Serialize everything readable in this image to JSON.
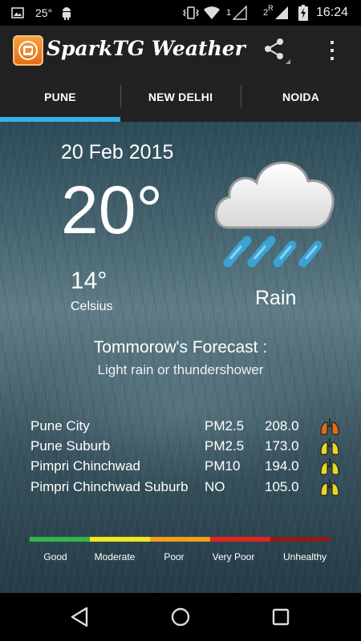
{
  "status_bar": {
    "temperature": "25°",
    "sim1": "1",
    "sim2": "2",
    "roaming": "R",
    "time": "16:24"
  },
  "app_bar": {
    "title": "SparkTG Weather"
  },
  "tabs": [
    {
      "label": "PUNE",
      "selected": true
    },
    {
      "label": "NEW DELHI",
      "selected": false
    },
    {
      "label": "NOIDA",
      "selected": false
    }
  ],
  "weather": {
    "date": "20 Feb 2015",
    "temperature": "20°",
    "low_temperature": "14°",
    "unit": "Celsius",
    "condition": "Rain",
    "condition_icon": "rain-cloud-icon"
  },
  "forecast": {
    "title": "Tommorow's  Forecast :",
    "text": "Light rain or thundershower"
  },
  "air_quality": [
    {
      "location": "Pune City",
      "pollutant": "PM2.5",
      "value": "208.0",
      "lung_color": "#e36b12"
    },
    {
      "location": "Pune Suburb",
      "pollutant": "PM2.5",
      "value": "173.0",
      "lung_color": "#e6d620"
    },
    {
      "location": "Pimpri Chinchwad",
      "pollutant": "PM10",
      "value": "194.0",
      "lung_color": "#e6d620"
    },
    {
      "location": "Pimpri Chinchwad Suburb",
      "pollutant": "NO",
      "value": "105.0",
      "lung_color": "#e6d620"
    }
  ],
  "scale": [
    {
      "label": "Good",
      "color": "#35b34a"
    },
    {
      "label": "Moderate",
      "color": "#f3e61f"
    },
    {
      "label": "Poor",
      "color": "#f39c19"
    },
    {
      "label": "Very Poor",
      "color": "#e2241d"
    },
    {
      "label": "Unhealthy",
      "color": "#8e1b1b"
    }
  ],
  "nav_bar": {
    "back_icon": "back-icon",
    "home_icon": "home-icon",
    "recents_icon": "recents-icon"
  }
}
